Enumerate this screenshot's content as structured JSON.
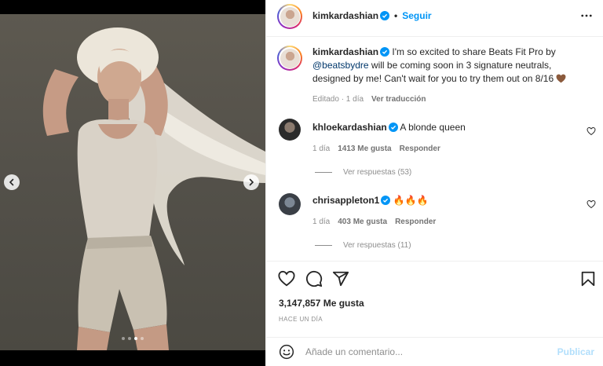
{
  "post": {
    "username": "kimkardashian",
    "follow_label": "Seguir",
    "separator": "•",
    "image_count": 4,
    "active_image": 3
  },
  "caption": {
    "username": "kimkardashian",
    "text_before_mention": " I'm so excited to share Beats Fit Pro by ",
    "mention": "@beatsbydre",
    "text_after_mention": " will be coming soon in 3 signature neutrals, designed by me! Can't wait for you to try them out on 8/16",
    "edited": "Editado · 1 día",
    "translate": "Ver traducción"
  },
  "comments": [
    {
      "username": "khloekardashian",
      "text": " A blonde queen",
      "age": "1 día",
      "likes": "1413 Me gusta",
      "reply": "Responder",
      "view_replies": "Ver respuestas (53)"
    },
    {
      "username": "chrisappleton1",
      "text": " 🔥🔥🔥",
      "age": "1 día",
      "likes": "403 Me gusta",
      "reply": "Responder",
      "view_replies": "Ver respuestas (11)"
    }
  ],
  "engagement": {
    "likes": "3,147,857 Me gusta",
    "time": "Hace un día"
  },
  "comment_box": {
    "placeholder": "Añade un comentario...",
    "post_label": "Publicar"
  },
  "icons": [
    "chevron-left-icon",
    "chevron-right-icon",
    "more-icon",
    "verified-icon",
    "heart-icon",
    "comment-icon",
    "share-icon",
    "bookmark-icon",
    "emoji-icon"
  ],
  "colors": {
    "accent": "#0095f6",
    "verified": "#0095f6",
    "muted": "#8e8e8e",
    "post_disabled": "#b2dffc"
  }
}
